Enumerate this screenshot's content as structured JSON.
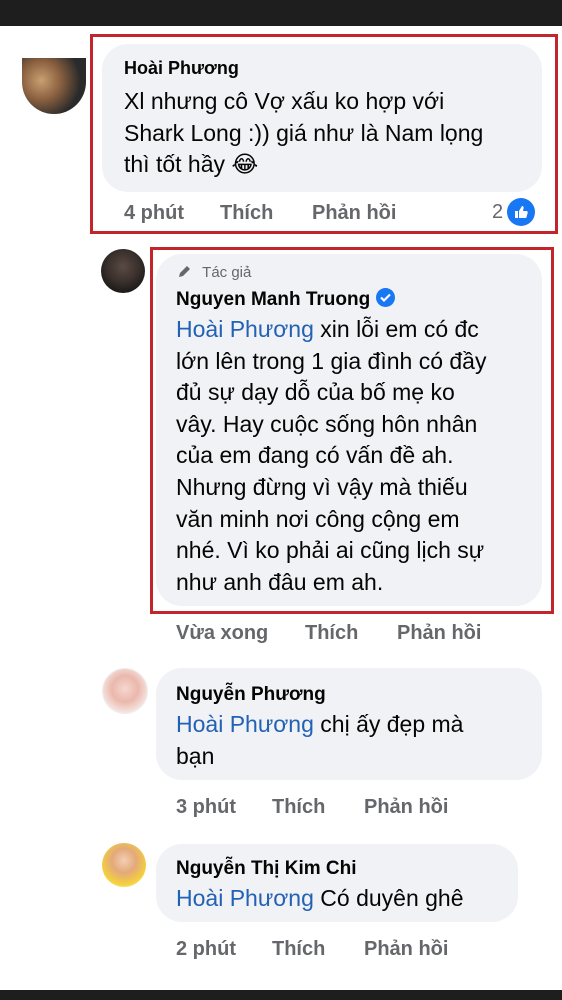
{
  "comments": [
    {
      "author": "Hoài Phương",
      "lines": [
        "Xl nhưng cô Vợ xấu ko hợp với",
        "Shark Long  :)) giá như là Nam lọng",
        "thì tốt hầy"
      ],
      "emoji": "😂",
      "time": "4 phút",
      "like": "Thích",
      "reply": "Phản hồi",
      "reaction_count": "2"
    },
    {
      "author_tag": "Tác giả",
      "author": "Nguyen Manh Truong",
      "mention": "Hoài Phương",
      "lines": [
        " xin lỗi em có đc",
        "lớn lên trong 1 gia đình có đầy",
        "đủ sự dạy dỗ của bố mẹ ko",
        "vây. Hay cuộc sống hôn nhân",
        "của em đang có vấn đề ah.",
        "Nhưng đừng vì vậy mà thiếu",
        "văn minh nơi công cộng em",
        "nhé. Vì ko phải ai cũng lịch sự",
        "như anh đâu em ah."
      ],
      "time": "Vừa xong",
      "like": "Thích",
      "reply": "Phản hồi"
    },
    {
      "author": "Nguyễn Phương",
      "mention": "Hoài Phương",
      "lines": [
        " chị ấy đẹp mà",
        "bạn"
      ],
      "time": "3 phút",
      "like": "Thích",
      "reply": "Phản hồi"
    },
    {
      "author": "Nguyễn Thị Kim Chi",
      "mention": "Hoài Phương",
      "lines": [
        " Có duyên ghê"
      ],
      "time": "2 phút",
      "like": "Thích",
      "reply": "Phản hồi"
    }
  ],
  "colors": {
    "bubble": "#f0f2f5",
    "mention": "#2361b4",
    "muted": "#65676b",
    "highlight_box": "#c2252c",
    "like_blue": "#1877f2"
  },
  "icons": [
    "pencil-icon",
    "verified-badge-icon",
    "like-thumb-icon"
  ]
}
